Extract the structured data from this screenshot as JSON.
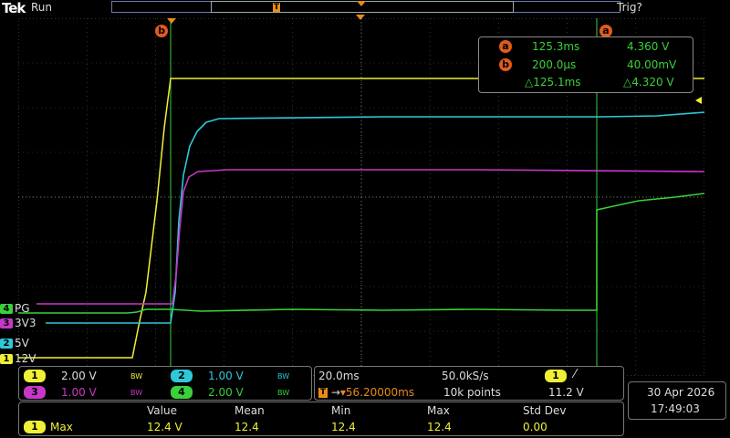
{
  "header": {
    "logo": "Tek",
    "status": "Run",
    "trigger_status": "Trig?",
    "trigger_position_marker": "T"
  },
  "channel_labels": [
    {
      "num": "4",
      "name": "PG",
      "color": "#3ad13a"
    },
    {
      "num": "3",
      "name": "3V3",
      "color": "#c838c8"
    },
    {
      "num": "2",
      "name": "5V",
      "color": "#2ec8d8"
    },
    {
      "num": "1",
      "name": "12V",
      "color": "#f0f036"
    }
  ],
  "cursor_markers": {
    "a": "a",
    "b": "b"
  },
  "cursor_readout": {
    "a_label": "a",
    "a_time": "125.3ms",
    "a_value": "4.360 V",
    "b_label": "b",
    "b_time": "200.0µs",
    "b_value": "40.00mV",
    "delta_time": "△125.1ms",
    "delta_value": "△4.320 V"
  },
  "vertical": [
    {
      "num": "1",
      "scale": "2.00 V",
      "bw": "BW",
      "color": "#f0f036"
    },
    {
      "num": "2",
      "scale": "1.00 V",
      "bw": "BW",
      "color": "#2ec8d8"
    },
    {
      "num": "3",
      "scale": "1.00 V",
      "bw": "BW",
      "color": "#c838c8"
    },
    {
      "num": "4",
      "scale": "2.00 V",
      "bw": "BW",
      "color": "#3ad13a"
    }
  ],
  "horizontal": {
    "time_div": "20.0ms",
    "sample_rate": "50.0kS/s",
    "trigger_delay": "56.20000ms",
    "record_length": "10k points"
  },
  "trigger": {
    "source": "1",
    "slope": "⁄",
    "level": "11.2 V"
  },
  "datetime": {
    "date": "30 Apr  2026",
    "time": "17:49:03"
  },
  "measurements": {
    "headers": [
      "Value",
      "Mean",
      "Min",
      "Max",
      "Std Dev"
    ],
    "rows": [
      {
        "channel": "1",
        "type": "Max",
        "value": "12.4 V",
        "mean": "12.4",
        "min": "12.4",
        "max": "12.4",
        "std": "0.00"
      }
    ]
  },
  "colors": {
    "ch1": "#f0f036",
    "ch2": "#2ec8d8",
    "ch3": "#c838c8",
    "ch4": "#3ad13a",
    "cursor": "#e25a1e"
  }
}
